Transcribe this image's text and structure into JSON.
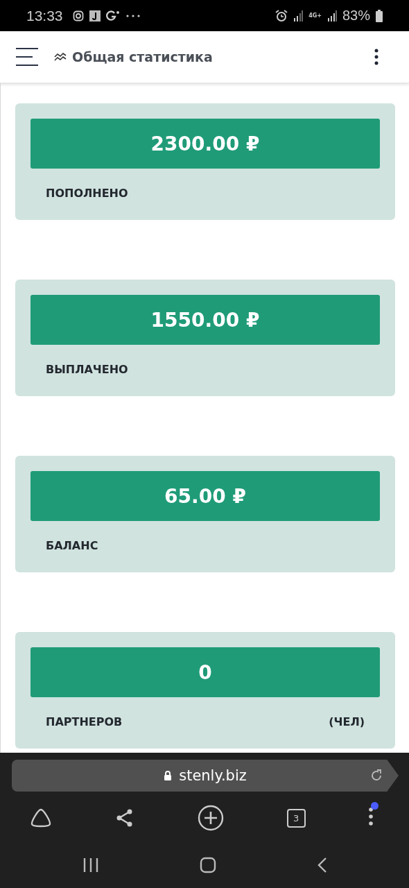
{
  "status_bar": {
    "time": "13:33",
    "network": "4G+",
    "battery": "83%"
  },
  "header": {
    "title": "Общая статистика"
  },
  "cards": [
    {
      "value": "2300.00 ₽",
      "label": "ПОПОЛНЕНО"
    },
    {
      "value": "1550.00 ₽",
      "label": "ВЫПЛАЧЕНО"
    },
    {
      "value": "65.00 ₽",
      "label": "БАЛАНС"
    },
    {
      "value": "0",
      "label": "ПАРТНЕРОВ",
      "unit": "(ЧЕЛ)"
    }
  ],
  "browser": {
    "url": "stenly.biz",
    "tab_count": "3",
    "menu_badge": true
  }
}
